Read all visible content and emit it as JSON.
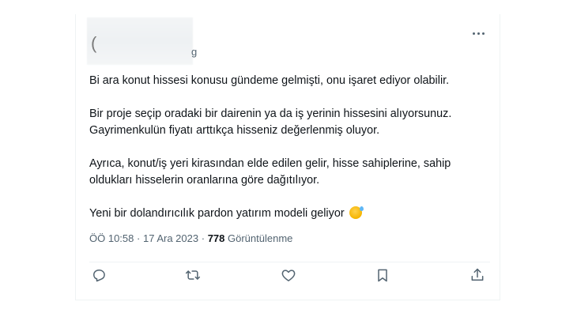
{
  "header": {
    "avatar_glyph": "(",
    "handle_tail": "g"
  },
  "tweet": {
    "paragraphs": [
      "Bi ara konut hissesi konusu gündeme gelmişti, onu işaret ediyor olabilir.",
      "Bir proje seçip oradaki bir dairenin ya da iş yerinin hissesini alıyorsunuz.\nGayrimenkulün fiyatı arttıkça hisseniz değerlenmiş oluyor.",
      "Ayrıca, konut/iş yeri kirasından elde edilen gelir, hisse sahiplerine, sahip\noldukları hisselerin oranlarına göre dağıtılıyor.",
      "Yeni bir dolandırıcılık pardon yatırım modeli geliyor"
    ],
    "emoji": "grinning-face-with-sweat"
  },
  "meta": {
    "time": "ÖÖ 10:58",
    "separator": "·",
    "date": "17 Ara 2023",
    "views_count": "778",
    "views_label": "Görüntülenme"
  },
  "actions": {
    "icons": [
      "reply-icon",
      "retweet-icon",
      "like-icon",
      "bookmark-icon",
      "share-icon"
    ],
    "icon_color": "#536471"
  },
  "colors": {
    "text": "#0f1419",
    "secondary": "#536471",
    "border": "#eff3f4"
  }
}
